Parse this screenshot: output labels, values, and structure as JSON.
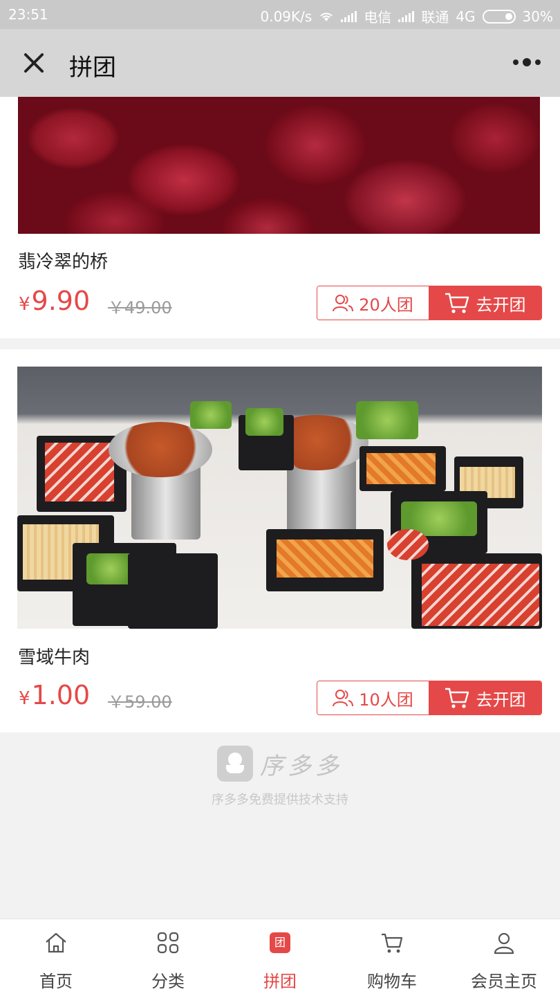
{
  "status_bar": {
    "time": "23:51",
    "speed": "0.09K/s",
    "carrier1": "电信",
    "carrier2": "联通",
    "network": "4G",
    "battery": "30%"
  },
  "title_bar": {
    "title": "拼团"
  },
  "products": [
    {
      "name": "翡冷翠的桥",
      "currency": "¥",
      "price": "9.90",
      "original_price": "￥49.00",
      "group_size": "20人团",
      "action": "去开团"
    },
    {
      "name": "雪域牛肉",
      "currency": "¥",
      "price": "1.00",
      "original_price": "￥59.00",
      "group_size": "10人团",
      "action": "去开团"
    }
  ],
  "footer": {
    "brand_name": "序多多",
    "tagline": "序多多免费提供技术支持"
  },
  "tabbar": {
    "items": [
      {
        "label": "首页",
        "icon": "home-icon"
      },
      {
        "label": "分类",
        "icon": "grid-icon"
      },
      {
        "label": "拼团",
        "icon": "group-badge-icon",
        "badge": "团",
        "active": true
      },
      {
        "label": "购物车",
        "icon": "cart-icon"
      },
      {
        "label": "会员主页",
        "icon": "user-icon"
      }
    ]
  },
  "colors": {
    "accent": "#e54848",
    "title_bar_bg": "#d6d6d6",
    "status_bar_bg": "#c9c9c9"
  }
}
